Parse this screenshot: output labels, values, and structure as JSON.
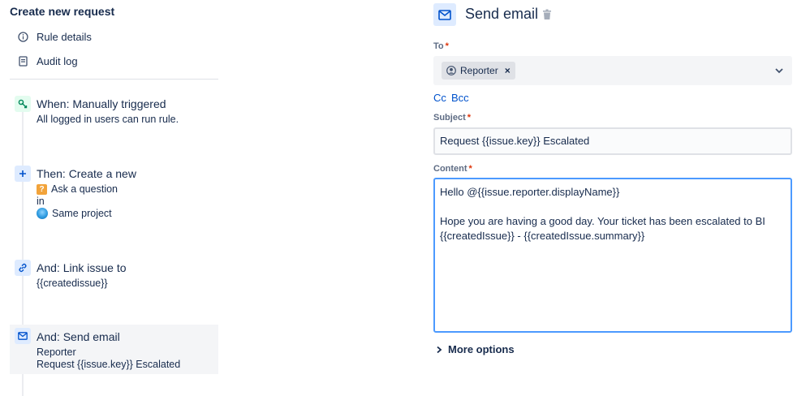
{
  "left": {
    "title": "Create new request",
    "nav": [
      {
        "label": "Rule details",
        "icon": "info-icon"
      },
      {
        "label": "Audit log",
        "icon": "document-icon"
      }
    ],
    "steps": [
      {
        "heading": "When: Manually triggered",
        "lines": [
          "All logged in users can run rule."
        ],
        "icon": "pointer-click-icon",
        "badge_color": "#e3fcef"
      },
      {
        "heading": "Then: Create a new",
        "lines": [
          "Ask a question",
          "in",
          "Same project"
        ],
        "icon": "plus-icon",
        "badge_color": "#deebff"
      },
      {
        "heading": "And: Link issue to",
        "lines": [
          "{{createdissue}}"
        ],
        "icon": "link-icon",
        "badge_color": "#deebff"
      },
      {
        "heading": "And: Send email",
        "lines": [
          "Reporter",
          "Request {{issue.key}} Escalated"
        ],
        "icon": "mail-icon",
        "badge_color": "#deebff"
      }
    ]
  },
  "panel": {
    "title": "Send email",
    "icon": "mail-icon",
    "to": {
      "label": "To",
      "required_mark": "*",
      "chip": "Reporter",
      "chip_remove": "×"
    },
    "cc": "Cc",
    "bcc": "Bcc",
    "subject": {
      "label": "Subject",
      "required_mark": "*",
      "value": "Request {{issue.key}} Escalated"
    },
    "content": {
      "label": "Content",
      "required_mark": "*",
      "value": "Hello @{{issue.reporter.displayName}}\n\nHope you are having a good day. Your ticket has been escalated to BI\n{{createdIssue}} - {{createdIssue.summary}}"
    },
    "more_options": "More options"
  },
  "colors": {
    "accent": "#0052cc",
    "focus_border": "#4c9aff",
    "required": "#de350b",
    "text": "#172b4d"
  }
}
